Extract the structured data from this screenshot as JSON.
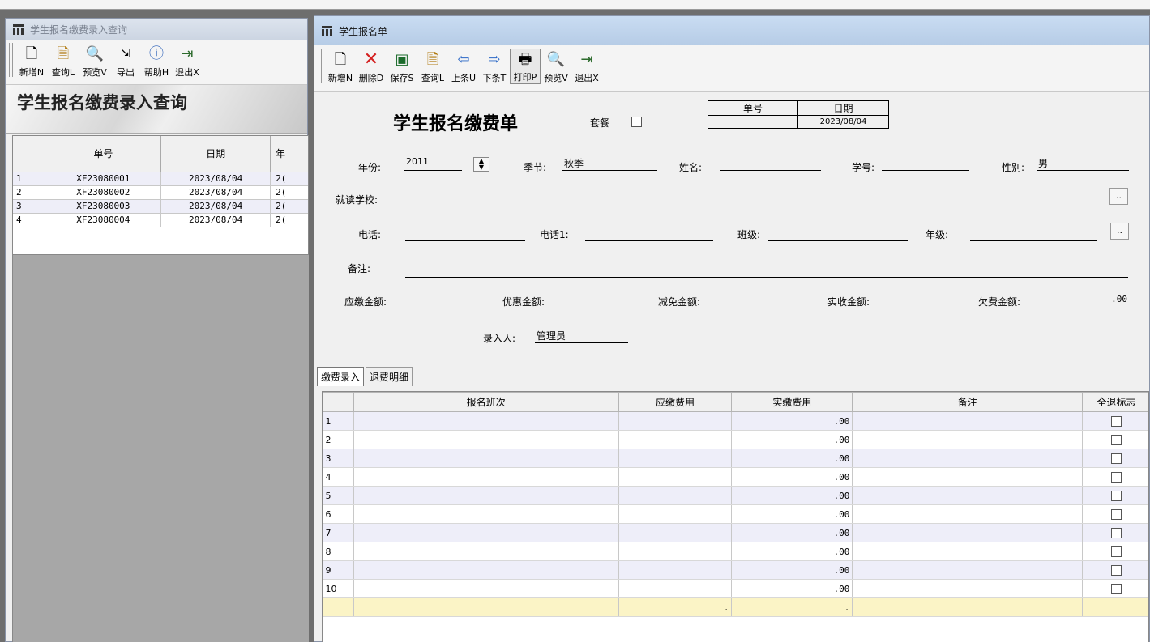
{
  "left_window": {
    "title": "学生报名缴费录入查询",
    "toolbar": [
      {
        "label": "新增N",
        "icon": "new-doc-icon"
      },
      {
        "label": "查询L",
        "icon": "query-icon"
      },
      {
        "label": "预览V",
        "icon": "preview-icon"
      },
      {
        "label": "导出",
        "icon": "export-icon"
      },
      {
        "label": "帮助H",
        "icon": "help-icon"
      },
      {
        "label": "退出X",
        "icon": "exit-icon"
      }
    ],
    "banner": "学生报名缴费录入查询",
    "grid": {
      "columns": [
        "",
        "单号",
        "日期",
        "年"
      ],
      "rows": [
        {
          "n": "1",
          "no": "XF23080001",
          "date": "2023/08/04",
          "y": "2("
        },
        {
          "n": "2",
          "no": "XF23080002",
          "date": "2023/08/04",
          "y": "2("
        },
        {
          "n": "3",
          "no": "XF23080003",
          "date": "2023/08/04",
          "y": "2("
        },
        {
          "n": "4",
          "no": "XF23080004",
          "date": "2023/08/04",
          "y": "2("
        }
      ]
    }
  },
  "right_window": {
    "title": "学生报名单",
    "toolbar": [
      {
        "label": "新增N",
        "icon": "new-doc-icon"
      },
      {
        "label": "删除D",
        "icon": "delete-icon"
      },
      {
        "label": "保存S",
        "icon": "save-icon"
      },
      {
        "label": "查询L",
        "icon": "query-icon"
      },
      {
        "label": "上条U",
        "icon": "prev-arrow-icon"
      },
      {
        "label": "下条T",
        "icon": "next-arrow-icon"
      },
      {
        "label": "打印P",
        "icon": "print-icon"
      },
      {
        "label": "预览V",
        "icon": "preview-icon"
      },
      {
        "label": "退出X",
        "icon": "exit-icon"
      }
    ],
    "form": {
      "heading": "学生报名缴费单",
      "package_label": "套餐",
      "docno_header": "单号",
      "date_header": "日期",
      "docno_value": "",
      "date_value": "2023/08/04",
      "year_label": "年份:",
      "year_value": "2011",
      "season_label": "季节:",
      "season_value": "秋季",
      "name_label": "姓名:",
      "name_value": "",
      "studentid_label": "学号:",
      "studentid_value": "",
      "gender_label": "性别:",
      "gender_value": "男",
      "school_label": "就读学校:",
      "school_value": "",
      "phone_label": "电话:",
      "phone_value": "",
      "phone1_label": "电话1:",
      "phone1_value": "",
      "class_label": "班级:",
      "class_value": "",
      "grade_label": "年级:",
      "grade_value": "",
      "remark_label": "备注:",
      "remark_value": "",
      "due_label": "应缴金额:",
      "due_value": "",
      "discount_label": "优惠金额:",
      "discount_value": "",
      "waiver_label": "减免金额:",
      "waiver_value": "",
      "received_label": "实收金额:",
      "received_value": "",
      "owed_label": "欠费金额:",
      "owed_value": ".00",
      "entered_by_label": "录入人:",
      "entered_by_value": "管理员",
      "ellipsis": ".."
    },
    "tabs": [
      "缴费录入",
      "退费明细"
    ],
    "grid": {
      "columns": [
        "",
        "报名班次",
        "应缴费用",
        "实缴费用",
        "备注",
        "全退标志"
      ],
      "rows": [
        {
          "n": "1",
          "paid": ".00"
        },
        {
          "n": "2",
          "paid": ".00"
        },
        {
          "n": "3",
          "paid": ".00"
        },
        {
          "n": "4",
          "paid": ".00"
        },
        {
          "n": "5",
          "paid": ".00"
        },
        {
          "n": "6",
          "paid": ".00"
        },
        {
          "n": "7",
          "paid": ".00"
        },
        {
          "n": "8",
          "paid": ".00"
        },
        {
          "n": "9",
          "paid": ".00"
        },
        {
          "n": "10",
          "paid": ".00"
        }
      ],
      "totals": {
        "due": ".",
        "paid": "."
      }
    }
  }
}
